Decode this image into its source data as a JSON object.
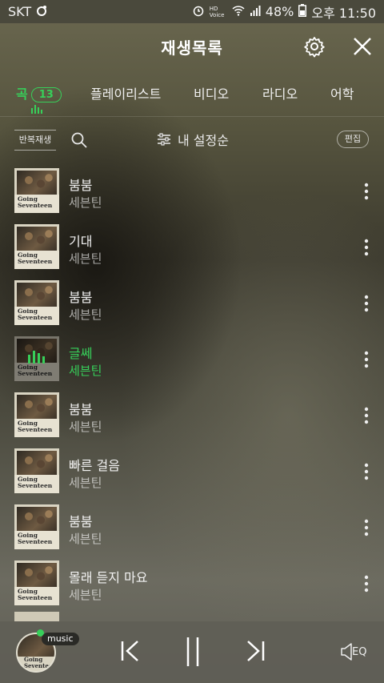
{
  "statusbar": {
    "carrier": "SKT",
    "voice_label": "HD Voice",
    "battery": "48%",
    "time": "오후 11:50"
  },
  "header": {
    "title": "재생목록"
  },
  "tabs": [
    {
      "label": "곡",
      "count": "13"
    },
    {
      "label": "플레이리스트"
    },
    {
      "label": "비디오"
    },
    {
      "label": "라디오"
    },
    {
      "label": "어학"
    }
  ],
  "toolbar": {
    "repeat_label": "반복재생",
    "sort_label": "내 설정순",
    "edit_label": "편집"
  },
  "album": {
    "line1": "Going",
    "line2": "Seventeen"
  },
  "songs": [
    {
      "title": "붐붐",
      "artist": "세븐틴"
    },
    {
      "title": "기대",
      "artist": "세븐틴"
    },
    {
      "title": "붐붐",
      "artist": "세븐틴"
    },
    {
      "title": "글쎄",
      "artist": "세븐틴",
      "playing": true
    },
    {
      "title": "붐붐",
      "artist": "세븐틴"
    },
    {
      "title": "빠른 걸음",
      "artist": "세븐틴"
    },
    {
      "title": "붐붐",
      "artist": "세븐틴"
    },
    {
      "title": "몰래 듣지 마요",
      "artist": "세븐틴"
    }
  ],
  "player": {
    "badge": "music",
    "eq_label": "EQ"
  },
  "colors": {
    "accent": "#37d05a"
  }
}
